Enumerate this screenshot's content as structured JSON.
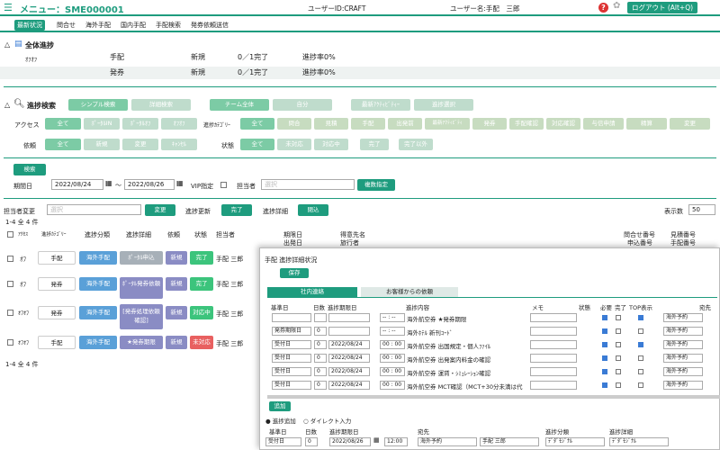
{
  "header": {
    "menu_title": "メニュー：SME000001",
    "user_id": "ユーザーID:CRAFT",
    "user_name": "ユーザー名:手配　三郎",
    "logout": "ログアウト (Alt+Q)"
  },
  "tabs": [
    "最新状況",
    "問合せ",
    "海外手配",
    "国内手配",
    "手配検索",
    "発券依頼送信"
  ],
  "overall": {
    "title": "全体進捗",
    "rows": [
      {
        "who": "ｵﾌｵﾌ",
        "kind": "手配",
        "status": "新規",
        "count": "0／1完了",
        "rate": "進捗率0%"
      },
      {
        "who": "",
        "kind": "発券",
        "status": "新規",
        "count": "0／1完了",
        "rate": "進捗率0%"
      }
    ]
  },
  "search": {
    "title": "進捗検索",
    "mode_buttons": [
      "シンプル検索",
      "詳細検索",
      "チーム全体",
      "自分",
      "最新ｱｸﾃｨﾋﾞﾃｨｰ",
      "進捗選択"
    ],
    "access_label": "アクセス",
    "access": [
      "全て",
      "ﾎﾟｰﾀﾙIN",
      "ﾎﾟｰﾀﾙｵﾌ",
      "ｵﾌｵﾌ"
    ],
    "cat_label": "進捗ｶﾃｺﾞﾘｰ",
    "cats": [
      "全て",
      "問合",
      "見積",
      "手配",
      "出発前",
      "最新ｱｸﾃｨﾋﾞﾃｨ",
      "発券",
      "手配確認",
      "対応確認",
      "与信申請",
      "精算",
      "変更"
    ],
    "req_label": "依頼",
    "reqs": [
      "全て",
      "新規",
      "変更",
      "ｷｬﾝｾﾙ"
    ],
    "state_label": "状態",
    "states": [
      "全て",
      "未対応",
      "対応中",
      "完了",
      "完了以外"
    ],
    "search_btn": "検索",
    "period_label": "期間日",
    "date_from": "2022/08/24",
    "tilde": "～",
    "date_to": "2022/08/26",
    "vip_label": "VIP指定",
    "staff_label": "担当者",
    "staff_ph": "選択",
    "multi_btn": "複数指定"
  },
  "bulk": {
    "label": "担当者変更",
    "ph": "選択",
    "change": "変更",
    "update_label": "進捗更新",
    "done": "完了",
    "detail_label": "進捗詳細",
    "close": "閉込",
    "count": "1-4 全 4 件",
    "page_label": "表示数",
    "page_size": "50"
  },
  "list_headers": [
    "ｱｸｾｽ",
    "進捗ｶﾃｺﾞﾘｰ",
    "進捗分類",
    "進捗詳細",
    "依頼",
    "状態",
    "担当者",
    "期限日",
    "出発日",
    "得意先名",
    "旅行者",
    "問合せ番号",
    "申込番号",
    "見積番号",
    "手配番号"
  ],
  "rows": [
    {
      "access": "ｵﾌ",
      "cat": "手配",
      "cls": "海外手配",
      "detail": "ﾎﾟｰﾀﾙ申込",
      "req": "新規",
      "state": "完了",
      "staff": "手配 三郎"
    },
    {
      "access": "ｵﾌ",
      "cat": "発券",
      "cls": "海外手配",
      "detail": "ﾎﾟｰﾀﾙ発券依頼",
      "req": "新規",
      "state": "完了",
      "staff": "手配 三郎"
    },
    {
      "access": "ｵﾌｵﾌ",
      "cat": "発券",
      "cls": "海外手配",
      "detail": "[発券処理依頼確認]",
      "req": "新規",
      "state": "対応中",
      "staff": "手配 三郎"
    },
    {
      "access": "ｵﾌｵﾌ",
      "cat": "手配",
      "cls": "海外手配",
      "detail": "★発券期限",
      "req": "新規",
      "state": "未対応",
      "staff": "手配 三郎"
    }
  ],
  "bottom_count": "1-4 全 4 件",
  "modal": {
    "title": "手配 進捗詳細状況",
    "save": "保存",
    "tab1": "社内連絡",
    "tab2": "お客様からの依頼",
    "headers": [
      "基準日",
      "日数",
      "進捗期限日",
      "",
      "",
      "進捗内容",
      "メモ",
      "状態",
      "必要",
      "完了",
      "TOP表示",
      "宛先"
    ],
    "rows": [
      {
        "base": "",
        "days": "",
        "date": "",
        "time": "-- : --",
        "content": "海外航空券 ★発券期限",
        "dest": "海外予約"
      },
      {
        "base": "発券期限日",
        "days": "0",
        "date": "",
        "time": "-- : --",
        "content": "海外ﾎﾃﾙ 新刊ｺｰﾄﾞ",
        "dest": "海外予約"
      },
      {
        "base": "受付日",
        "days": "0",
        "date": "2022/08/24",
        "time": "00 : 00",
        "content": "海外航空券 出国規定・個人ﾌｧｲﾙ",
        "dest": "海外予約"
      },
      {
        "base": "受付日",
        "days": "0",
        "date": "2022/08/24",
        "time": "00 : 00",
        "content": "海外航空券 出発案内料金の確認",
        "dest": "海外予約"
      },
      {
        "base": "受付日",
        "days": "0",
        "date": "2022/08/24",
        "time": "00 : 00",
        "content": "海外航空券 運賃・ｼﾐｭﾚｰｼｮﾝ確認",
        "dest": "海外予約"
      },
      {
        "base": "受付日",
        "days": "0",
        "date": "2022/08/24",
        "time": "00 : 00",
        "content": "海外航空券 MCT確認（MCT+30分未満は代",
        "dest": "海外予約"
      }
    ],
    "add": "追加",
    "radio1": "進捗追加",
    "radio2": "ダイレクト入力",
    "form_headers": [
      "基準日",
      "日数",
      "進捗期限日",
      "",
      "宛先",
      "",
      "進捗分類",
      "進捗詳細"
    ],
    "form": {
      "base": "受付日",
      "days": "0",
      "date": "2022/08/26",
      "time": "12:00",
      "dest": "海外予約",
      "staff": "手配 三郎",
      "cls": "ﾃﾞﾀﾞﾓｼﾞﾅﾙ",
      "detail": "ﾃﾞﾀﾞﾓｼﾞﾅﾙ"
    }
  }
}
